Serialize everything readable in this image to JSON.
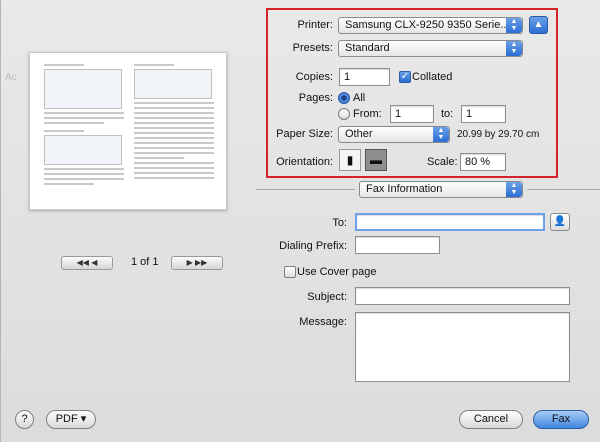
{
  "preview": {
    "page_indicator": "1 of 1",
    "first_icon": "first-page-icon",
    "prev_icon": "prev-page-icon",
    "next_icon": "next-page-icon",
    "last_icon": "last-page-icon"
  },
  "printer": {
    "label": "Printer:",
    "value": "Samsung CLX-9250 9350 Serie...",
    "collapse_icon": "collapse-triangle-icon"
  },
  "presets": {
    "label": "Presets:",
    "value": "Standard"
  },
  "copies": {
    "label": "Copies:",
    "value": "1",
    "collated_label": "Collated",
    "collated_checked": true
  },
  "pages": {
    "label": "Pages:",
    "all_label": "All",
    "from_label": "From:",
    "from_value": "1",
    "to_label": "to:",
    "to_value": "1"
  },
  "paper_size": {
    "label": "Paper Size:",
    "value": "Other",
    "dimensions": "20.99 by 29.70 cm"
  },
  "orientation": {
    "label": "Orientation:",
    "portrait_icon": "portrait-orientation-icon",
    "landscape_icon": "landscape-orientation-icon"
  },
  "scale": {
    "label": "Scale:",
    "value": "80 %"
  },
  "section": {
    "value": "Fax Information"
  },
  "fax": {
    "to_label": "To:",
    "to_value": "",
    "address_book_icon": "address-book-icon",
    "dialing_prefix_label": "Dialing Prefix:",
    "dialing_prefix_value": "",
    "cover_page_label": "Use Cover page",
    "subject_label": "Subject:",
    "subject_value": "",
    "message_label": "Message:"
  },
  "footer": {
    "help_label": "?",
    "pdf_label": "PDF ▾",
    "cancel_label": "Cancel",
    "fax_label": "Fax"
  },
  "colors": {
    "highlight_frame": "#d2232a",
    "accent": "#2c6ed5"
  }
}
